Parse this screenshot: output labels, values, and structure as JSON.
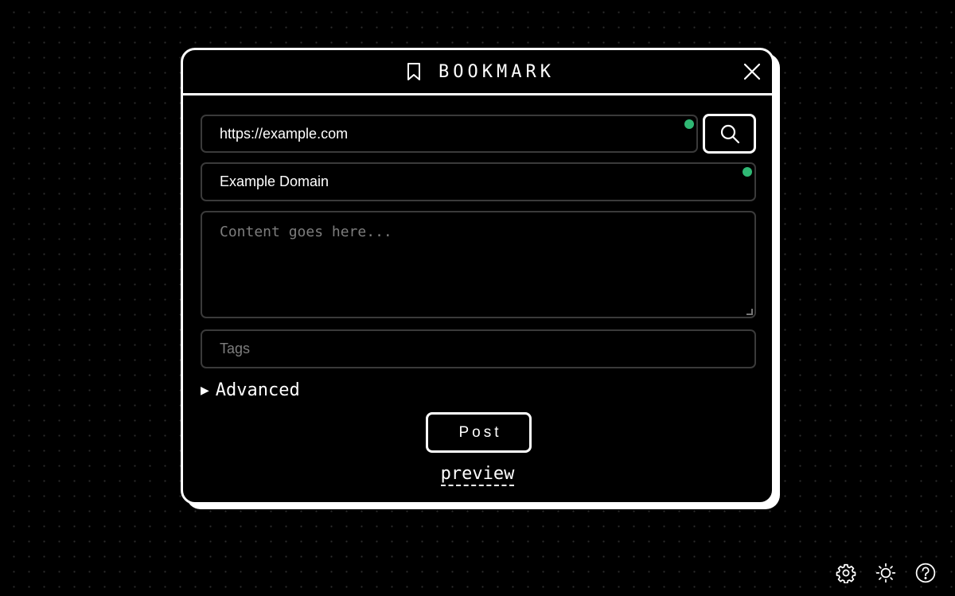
{
  "header": {
    "title": "BOOKMARK",
    "bookmark_icon": "bookmark-icon",
    "close_icon": "close-icon"
  },
  "form": {
    "url": {
      "value": "https://example.com",
      "status_color": "#2fb874"
    },
    "search_icon": "search-icon",
    "title": {
      "value": "Example Domain",
      "status_color": "#2fb874"
    },
    "content": {
      "placeholder": "Content goes here..."
    },
    "tags": {
      "placeholder": "Tags"
    },
    "advanced": {
      "arrow": "▶",
      "label": "Advanced"
    },
    "post_label": "Post",
    "preview_label": "preview"
  },
  "footer_icons": [
    "gear-icon",
    "sun-icon",
    "help-icon"
  ],
  "colors": {
    "background": "#000000",
    "foreground": "#ffffff",
    "status_ok": "#2fb874"
  }
}
